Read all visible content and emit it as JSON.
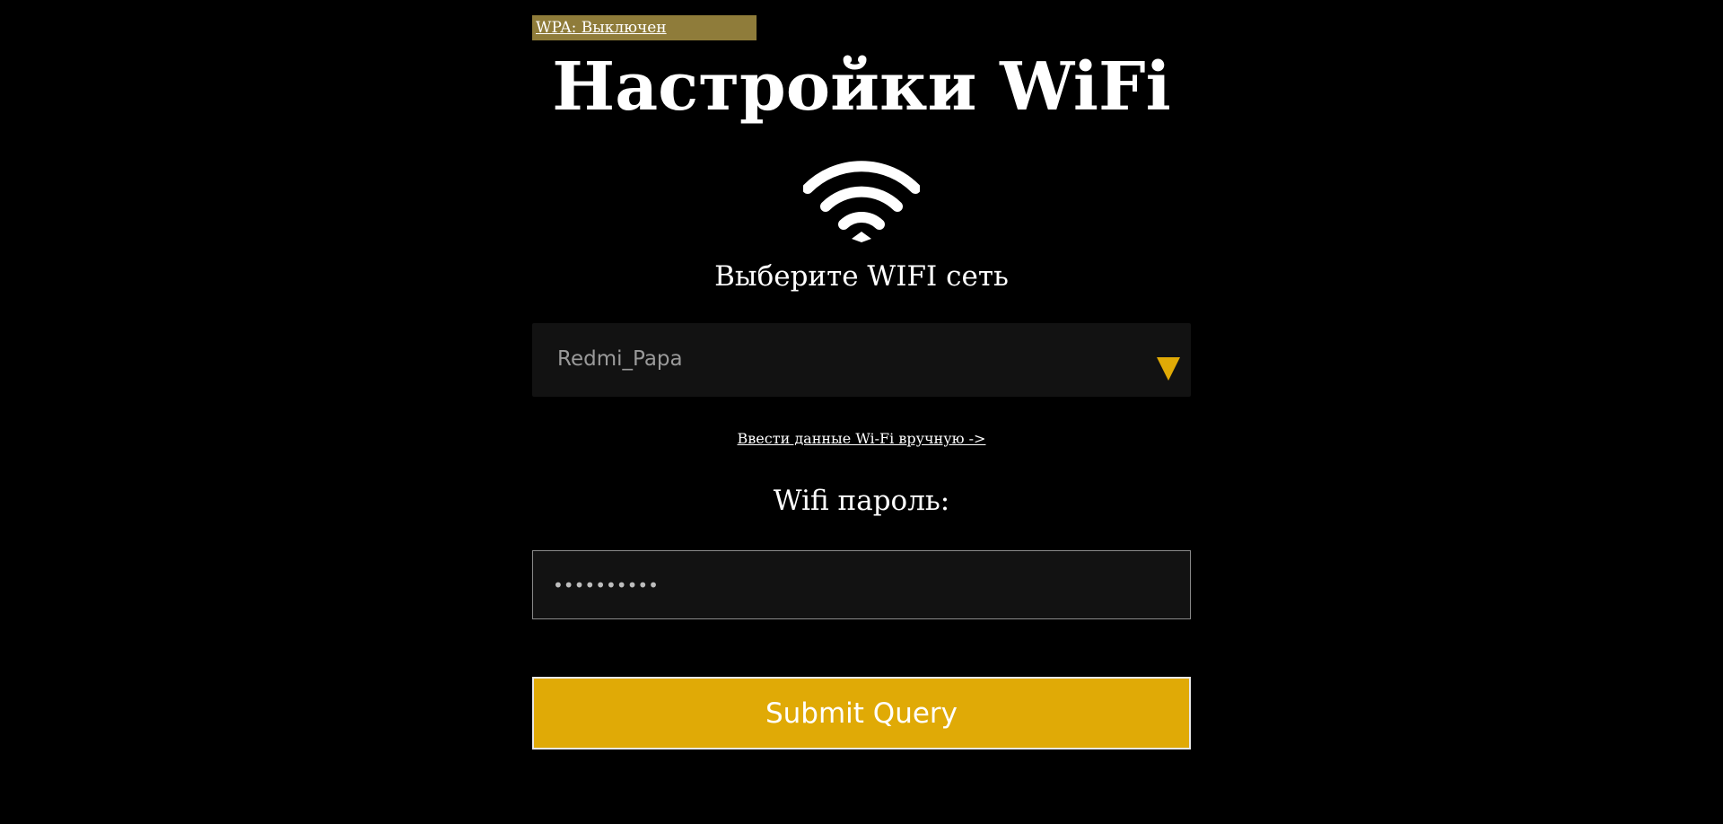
{
  "wpa_status": "WPA: Выключен",
  "page_title": "Настройки WiFi",
  "icons": {
    "wifi": "wifi-icon",
    "dropdown": "dropdown-arrow-icon"
  },
  "network": {
    "label": "Выберите WIFI сеть",
    "selected": "Redmi_Papa",
    "manual_link": "Ввести данные Wi-Fi вручную ->"
  },
  "password": {
    "label": "Wifi пароль:",
    "value": "••••••••••"
  },
  "submit_label": "Submit Query",
  "colors": {
    "background": "#000000",
    "accent": "#e0aa06",
    "badge": "#8f7c3a",
    "field_background": "#121212",
    "text": "#ffffff"
  }
}
